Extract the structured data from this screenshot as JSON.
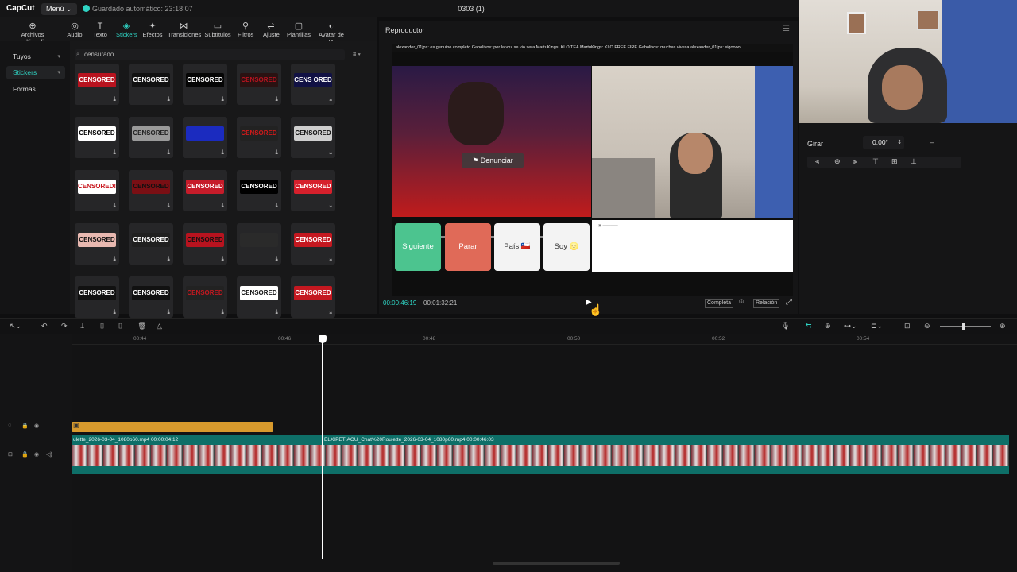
{
  "titlebar": {
    "logo": "CapCut",
    "menu": "Menú",
    "autosave": "Guardado automático: 23:18:07",
    "project_title": "0303 (1)"
  },
  "toolbar": {
    "items": [
      {
        "label": "Archivos multimedia",
        "icon": "media-icon"
      },
      {
        "label": "Audio",
        "icon": "audio-icon"
      },
      {
        "label": "Texto",
        "icon": "text-icon"
      },
      {
        "label": "Stickers",
        "icon": "stickers-icon"
      },
      {
        "label": "Efectos",
        "icon": "effects-icon"
      },
      {
        "label": "Transiciones",
        "icon": "transitions-icon"
      },
      {
        "label": "Subtítulos",
        "icon": "subtitles-icon"
      },
      {
        "label": "Filtros",
        "icon": "filters-icon"
      },
      {
        "label": "Ajuste",
        "icon": "adjust-icon"
      },
      {
        "label": "Plantillas",
        "icon": "templates-icon"
      },
      {
        "label": "Avatar de IA",
        "icon": "avatar-icon"
      }
    ],
    "active_index": 3
  },
  "leftnav": {
    "items": [
      "Tuyos",
      "Stickers",
      "Formas"
    ],
    "selected": 1
  },
  "library": {
    "search_value": "censurado",
    "stickers": [
      {
        "text": "CENSORED",
        "bg": "#b8131f",
        "fg": "#ffffff"
      },
      {
        "text": "CENSORED",
        "bg": "#111111",
        "fg": "#ffffff"
      },
      {
        "text": "CENSORED",
        "bg": "#050505",
        "fg": "#ffffff"
      },
      {
        "text": "CENSORED",
        "bg": "#2a1212",
        "fg": "#b8131f"
      },
      {
        "text": "CENS ORED",
        "bg": "#111144",
        "fg": "#ffffff"
      },
      {
        "text": "CENSORED",
        "bg": "#ffffff",
        "fg": "#000000"
      },
      {
        "text": "CENSORED",
        "bg": "#9a9a9a",
        "fg": "#222222"
      },
      {
        "text": "",
        "bg": "#1b2bbf",
        "fg": "#ffffff"
      },
      {
        "text": "CENSORED",
        "bg": "#222222",
        "fg": "#d11a1a"
      },
      {
        "text": "CENSORED",
        "bg": "#cfcfcf",
        "fg": "#111111"
      },
      {
        "text": "CENSORED!",
        "bg": "#ffffff",
        "fg": "#c8141b"
      },
      {
        "text": "CENSORED",
        "bg": "#7a0f14",
        "fg": "#111111"
      },
      {
        "text": "CENSORED",
        "bg": "#c61c2a",
        "fg": "#ffffff"
      },
      {
        "text": "CENSORED",
        "bg": "#000000",
        "fg": "#ffffff"
      },
      {
        "text": "CENSORED",
        "bg": "#d6202c",
        "fg": "#ffffff"
      },
      {
        "text": "CENSORED",
        "bg": "#e8b8b0",
        "fg": "#111111"
      },
      {
        "text": "CENSORED",
        "bg": "#202020",
        "fg": "#ffffff"
      },
      {
        "text": "CENSORED",
        "bg": "#b8131f",
        "fg": "#111111"
      },
      {
        "text": "",
        "bg": "#2a2a2a",
        "fg": "#ffffff"
      },
      {
        "text": "CENSORED",
        "bg": "#c41820",
        "fg": "#ffffff"
      },
      {
        "text": "CENSORED",
        "bg": "#111111",
        "fg": "#ffffff"
      },
      {
        "text": "CENSORED",
        "bg": "#111111",
        "fg": "#ffffff"
      },
      {
        "text": "CENSORED",
        "bg": "#222222",
        "fg": "#c41820"
      },
      {
        "text": "CENSORED",
        "bg": "#ffffff",
        "fg": "#111111"
      },
      {
        "text": "CENSORED",
        "bg": "#c41820",
        "fg": "#ffffff"
      }
    ]
  },
  "player": {
    "title": "Reproductor",
    "chat_line": "alexander_01jps: es genuino completo   Gabolivos: por la voz se vio sera   MartuKings: KLO TEA   MartuKings: KLO FREE FIRE   Gabolivos: muchas vivesa   alexander_01jps: sigoooo",
    "report_button": "Denunciar",
    "buttons": [
      {
        "label": "Siguiente",
        "bg": "#4cc48f",
        "fg": "#ffffff"
      },
      {
        "label": "Parar",
        "bg": "#e06a58",
        "fg": "#ffffff"
      },
      {
        "label": "País 🇨🇱",
        "bg": "#f3f3f3",
        "fg": "#333333"
      },
      {
        "label": "Soy 🌝",
        "bg": "#f3f3f3",
        "fg": "#333333"
      }
    ],
    "timecode_current": "00:00:46:19",
    "timecode_total": "00:01:32:21",
    "btn_full": "Completa",
    "btn_ratio": "Relación"
  },
  "props": {
    "rotate_label": "Girar",
    "rotate_value": "0.00°",
    "rotate_dash": "–"
  },
  "timeline": {
    "ruler_ticks": [
      "00:44",
      "00:46",
      "00:48",
      "00:50",
      "00:52",
      "00:54"
    ],
    "clip1_label": "ulette_2026-03-04_1080p60.mp4   00:00:04:12",
    "clip2_label": "ELXIPETIAOU_Chat%20Roulette_2026-03-04_1080p60.mp4   00:00:46:03"
  },
  "colors": {
    "accent": "#2fd3c3",
    "sticker_clip": "#d89a2d",
    "video_track": "#0e6f68"
  }
}
